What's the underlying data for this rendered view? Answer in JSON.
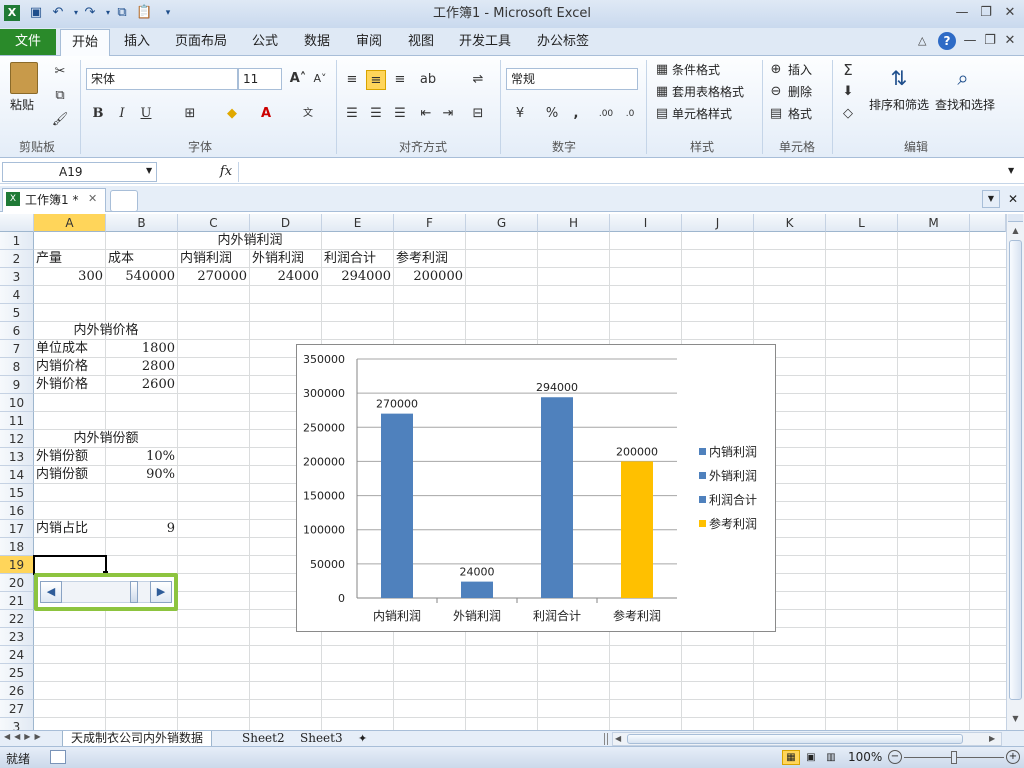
{
  "window": {
    "title": "工作簿1 - Microsoft Excel"
  },
  "ribbon_tabs": [
    "开始",
    "插入",
    "页面布局",
    "公式",
    "数据",
    "审阅",
    "视图",
    "开发工具",
    "办公标签"
  ],
  "file_tab": "文件",
  "ribbon": {
    "paste": "粘贴",
    "font_name": "宋体",
    "font_size": "11",
    "number_format": "常规",
    "cond_format": "条件格式",
    "table_format": "套用表格格式",
    "cell_style": "单元格样式",
    "insert": "插入",
    "delete": "删除",
    "format": "格式",
    "sort_filter": "排序和筛选",
    "find_select": "查找和选择",
    "groups": {
      "clipboard": "剪贴板",
      "font": "字体",
      "align": "对齐方式",
      "number": "数字",
      "styles": "样式",
      "cells": "单元格",
      "edit": "编辑"
    }
  },
  "formula_bar": {
    "name_box": "A19",
    "fx": "fx",
    "content": ""
  },
  "workbook_tab": "工作簿1 *",
  "columns": [
    "A",
    "B",
    "C",
    "D",
    "E",
    "F",
    "G",
    "H",
    "I",
    "J",
    "K",
    "L",
    "M"
  ],
  "rows": [
    "1",
    "2",
    "3",
    "4",
    "5",
    "6",
    "7",
    "8",
    "9",
    "10",
    "11",
    "12",
    "13",
    "14",
    "15",
    "16",
    "17",
    "18",
    "19",
    "20",
    "21",
    "22",
    "23",
    "24",
    "25",
    "26",
    "27",
    "3"
  ],
  "cells": {
    "C1": "内外销利润",
    "A2": "产量",
    "B2": "成本",
    "C2": "内销利润",
    "D2": "外销利润",
    "E2": "利润合计",
    "F2": "参考利润",
    "A3": "300",
    "B3": "540000",
    "C3": "270000",
    "D3": "24000",
    "E3": "294000",
    "F3": "200000",
    "A6": "内外销价格",
    "A7": "单位成本",
    "B7": "1800",
    "A8": "内销价格",
    "B8": "2800",
    "A9": "外销价格",
    "B9": "2600",
    "A12": "内外销份额",
    "A13": "外销份额",
    "B13": "10%",
    "A14": "内销份额",
    "B14": "90%",
    "A17": "内销占比",
    "B17": "9"
  },
  "sheets": [
    "天成制衣公司内外销数据",
    "Sheet2",
    "Sheet3"
  ],
  "status": {
    "ready": "就绪",
    "zoom": "100%"
  },
  "colors": {
    "blue": "#4f81bd",
    "gold": "#ffc000",
    "accent_green": "#8dc43f"
  },
  "chart_data": {
    "type": "bar",
    "categories": [
      "内销利润",
      "外销利润",
      "利润合计",
      "参考利润"
    ],
    "values": [
      270000,
      24000,
      294000,
      200000
    ],
    "data_labels": [
      "270000",
      "24000",
      "294000",
      "200000"
    ],
    "colors": [
      "#4f81bd",
      "#4f81bd",
      "#4f81bd",
      "#ffc000"
    ],
    "legend": [
      "内销利润",
      "外销利润",
      "利润合计",
      "参考利润"
    ],
    "legend_position": "right",
    "ylim": [
      0,
      350000
    ],
    "yticks": [
      "0",
      "50000",
      "100000",
      "150000",
      "200000",
      "250000",
      "300000",
      "350000"
    ],
    "grid": true
  }
}
